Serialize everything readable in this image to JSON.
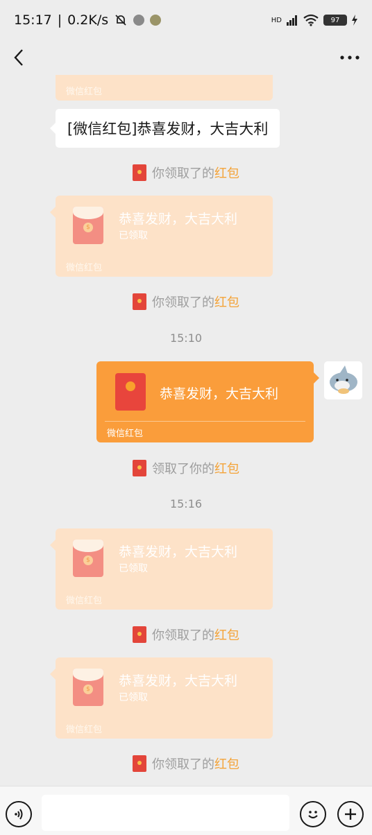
{
  "status_bar": {
    "time": "15:17",
    "network_speed": "0.2K/s",
    "signal_label": "HD",
    "battery": "97"
  },
  "icons": {
    "back": "chevron-left-icon",
    "more": "more-dots-icon",
    "voice": "voice-icon",
    "emoji": "emoji-icon",
    "plus": "plus-icon"
  },
  "colors": {
    "received_red_packet": "#fde2c8",
    "sent_red_packet": "#fa9d3b",
    "link": "#f4a338",
    "background": "#ededed"
  },
  "messages": {
    "partial_card_brand": "微信红包",
    "text_message": "[微信红包]恭喜发财，大吉大利",
    "notice_1": {
      "prefix": "你领取了的",
      "link": "红包"
    },
    "card_1": {
      "title": "恭喜发财，大吉大利",
      "status": "已领取",
      "brand": "微信红包"
    },
    "notice_2": {
      "prefix": "你领取了的",
      "link": "红包"
    },
    "time_1": "15:10",
    "sent_card": {
      "title": "恭喜发财，大吉大利",
      "brand": "微信红包"
    },
    "notice_3": {
      "prefix": "领取了你的",
      "link": "红包"
    },
    "time_2": "15:16",
    "card_2": {
      "title": "恭喜发财，大吉大利",
      "status": "已领取",
      "brand": "微信红包"
    },
    "notice_4": {
      "prefix": "你领取了的",
      "link": "红包"
    },
    "card_3": {
      "title": "恭喜发财，大吉大利",
      "status": "已领取",
      "brand": "微信红包"
    },
    "notice_5": {
      "prefix": "你领取了的",
      "link": "红包"
    }
  }
}
